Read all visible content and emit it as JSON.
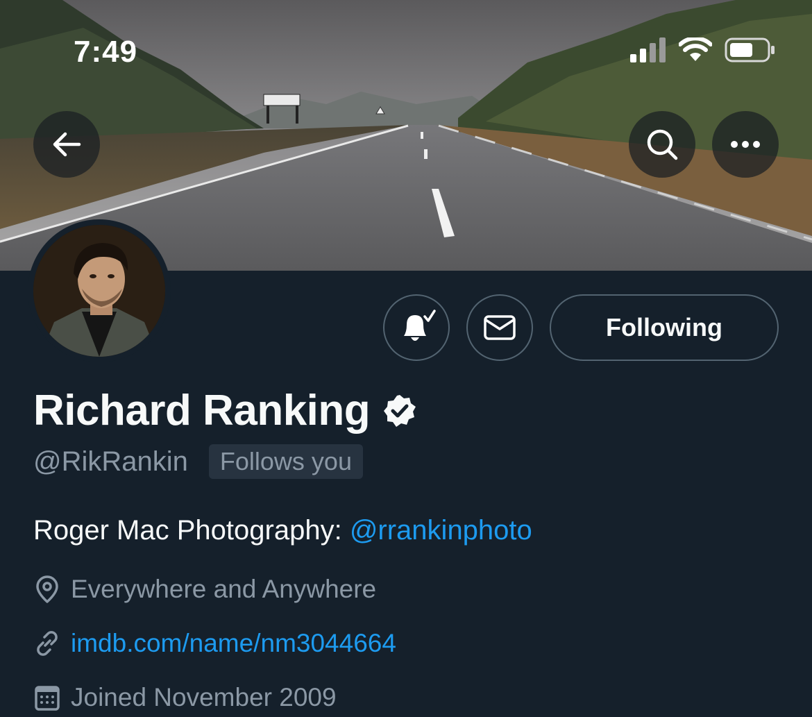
{
  "status_bar": {
    "time": "7:49",
    "icons": [
      "cellular-signal-icon",
      "wifi-icon",
      "battery-icon"
    ]
  },
  "nav": {
    "back_icon": "arrow-left-icon",
    "search_icon": "search-icon",
    "more_icon": "more-horizontal-icon"
  },
  "profile": {
    "name": "Richard Ranking",
    "verified": true,
    "handle": "@RikRankin",
    "follows_you": "Follows you",
    "bio_prefix": "Roger Mac Photography: ",
    "bio_mention": "@rrankinphoto",
    "location": "Everywhere and Anywhere",
    "website": "imdb.com/name/nm3044664",
    "joined": "Joined November 2009"
  },
  "actions": {
    "notifications_icon": "bell-subscribed-icon",
    "message_icon": "envelope-icon",
    "following_label": "Following"
  },
  "colors": {
    "background": "#15202b",
    "accent": "#1d9bf0",
    "secondary_text": "#8b98a5",
    "border": "#536471"
  }
}
